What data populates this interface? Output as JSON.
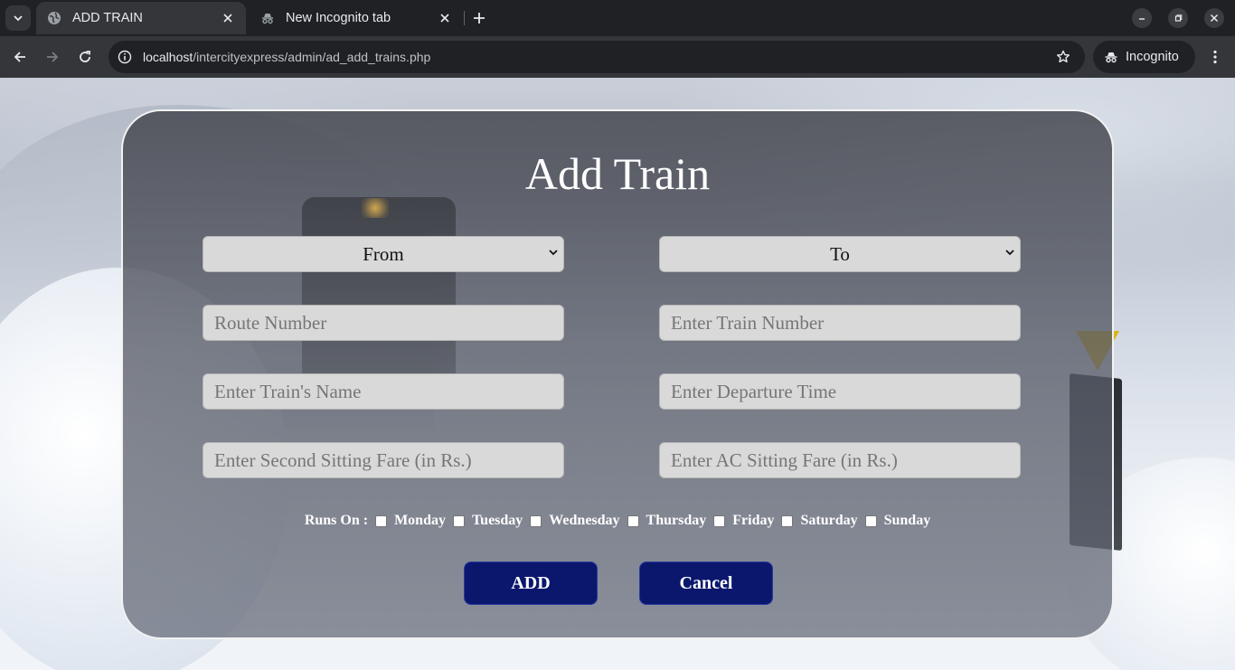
{
  "browser": {
    "tabs": [
      {
        "title": "ADD TRAIN",
        "active": true,
        "favicon": "globe-icon"
      },
      {
        "title": "New Incognito tab",
        "active": false,
        "favicon": "incognito-icon"
      }
    ],
    "url_host": "localhost",
    "url_path": "/intercityexpress/admin/ad_add_trains.php",
    "profile_label": "Incognito"
  },
  "form": {
    "title": "Add Train",
    "from_select": {
      "selected": "From"
    },
    "to_select": {
      "selected": "To"
    },
    "route_number_placeholder": "Route Number",
    "train_number_placeholder": "Enter Train Number",
    "train_name_placeholder": "Enter Train's Name",
    "departure_time_placeholder": "Enter Departure Time",
    "second_sitting_fare_placeholder": "Enter Second Sitting Fare (in Rs.)",
    "ac_sitting_fare_placeholder": "Enter AC Sitting Fare (in Rs.)",
    "runs_on_label": "Runs On :",
    "days": [
      "Monday",
      "Tuesday",
      "Wednesday",
      "Thursday",
      "Friday",
      "Saturday",
      "Sunday"
    ],
    "add_label": "ADD",
    "cancel_label": "Cancel"
  },
  "colors": {
    "button_bg": "#0a176d",
    "field_bg": "#d9d9d9",
    "chrome_dark": "#202124",
    "chrome_toolbar": "#35363a"
  }
}
